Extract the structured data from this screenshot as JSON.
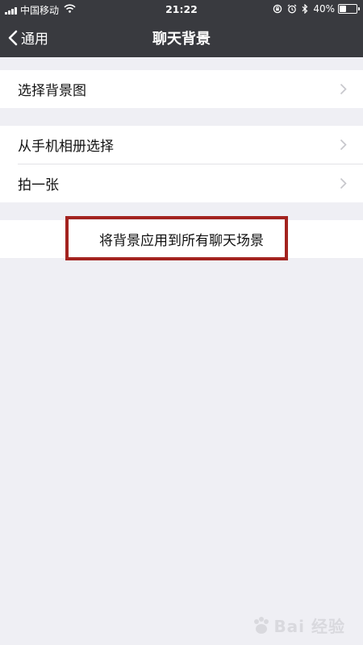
{
  "status_bar": {
    "carrier": "中国移动",
    "time": "21:22",
    "battery_text": "40%",
    "battery_level": 0.4
  },
  "nav": {
    "back_label": "通用",
    "title": "聊天背景"
  },
  "groups": [
    {
      "items": [
        {
          "label": "选择背景图"
        }
      ]
    },
    {
      "items": [
        {
          "label": "从手机相册选择"
        },
        {
          "label": "拍一张"
        }
      ]
    }
  ],
  "apply_action": {
    "label": "将背景应用到所有聊天场景"
  },
  "watermark": {
    "text": "Bai 经验"
  },
  "colors": {
    "nav_background": "#393a3f",
    "page_background": "#efeff4",
    "highlight_border": "#a3231f"
  }
}
